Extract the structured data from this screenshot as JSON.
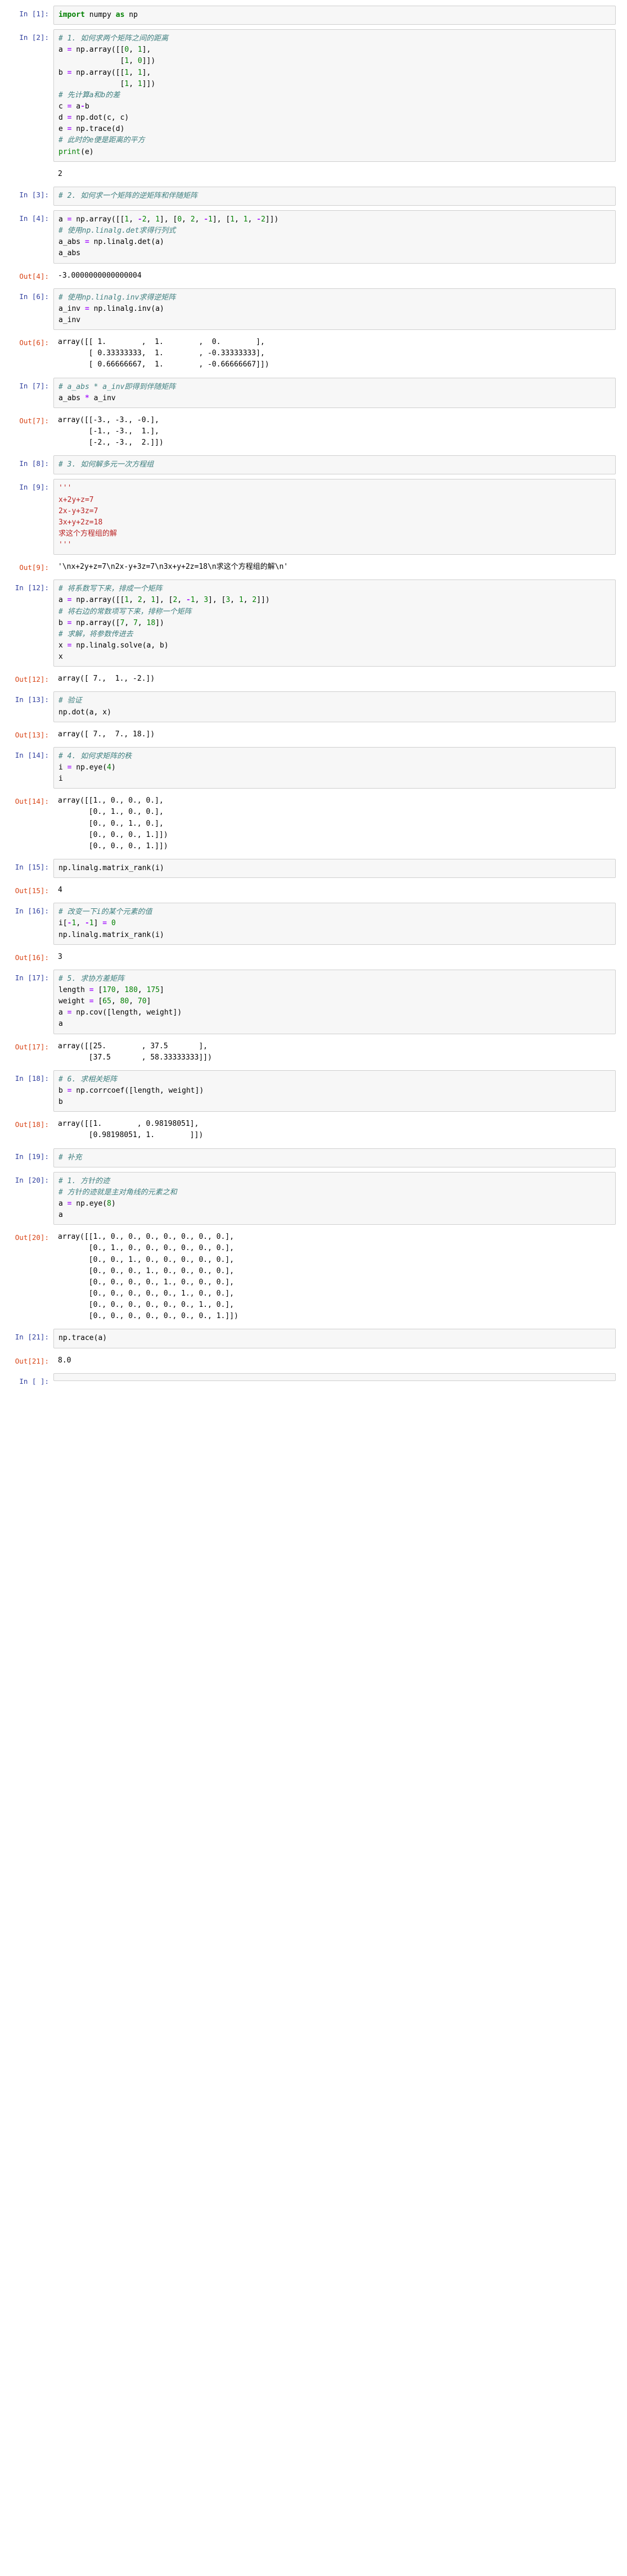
{
  "cells": [
    {
      "n": 1,
      "kind": "code",
      "source_html": "<span class='kw'>import</span> numpy <span class='kw'>as</span> np"
    },
    {
      "n": 2,
      "kind": "code",
      "source_html": "<span class='cm'># 1. 如何求两个矩阵之间的距离</span>\na <span class='op'>=</span> np.array([[<span class='num'>0</span>, <span class='num'>1</span>],\n              [<span class='num'>1</span>, <span class='num'>0</span>]])\nb <span class='op'>=</span> np.array([[<span class='num'>1</span>, <span class='num'>1</span>],\n              [<span class='num'>1</span>, <span class='num'>1</span>]])\n<span class='cm'># 先计算a和b的差</span>\nc <span class='op'>=</span> a<span class='op'>-</span>b\nd <span class='op'>=</span> np.dot(c, c)\ne <span class='op'>=</span> np.trace(d)\n<span class='cm'># 此时的e便是距离的平方</span>\n<span class='nm'>print</span>(e)",
      "stream": "2"
    },
    {
      "n": 3,
      "kind": "code",
      "source_html": "<span class='cm'># 2. 如何求一个矩阵的逆矩阵和伴随矩阵</span>"
    },
    {
      "n": 4,
      "kind": "code",
      "source_html": "a <span class='op'>=</span> np.array([[<span class='num'>1</span>, <span class='op'>-</span><span class='num'>2</span>, <span class='num'>1</span>], [<span class='num'>0</span>, <span class='num'>2</span>, <span class='op'>-</span><span class='num'>1</span>], [<span class='num'>1</span>, <span class='num'>1</span>, <span class='op'>-</span><span class='num'>2</span>]])\n<span class='cm'># 使用np.linalg.det求得行列式</span>\na_abs <span class='op'>=</span> np.linalg.det(a)\na_abs",
      "out": "-3.0000000000000004"
    },
    {
      "n": 6,
      "kind": "code",
      "source_html": "<span class='cm'># 使用np.linalg.inv求得逆矩阵</span>\na_inv <span class='op'>=</span> np.linalg.inv(a)\na_inv",
      "out": "array([[ 1.        ,  1.        ,  0.        ],\n       [ 0.33333333,  1.        , -0.33333333],\n       [ 0.66666667,  1.        , -0.66666667]])"
    },
    {
      "n": 7,
      "kind": "code",
      "source_html": "<span class='cm'># a_abs * a_inv即得到伴随矩阵</span>\na_abs <span class='op'>*</span> a_inv",
      "out": "array([[-3., -3., -0.],\n       [-1., -3.,  1.],\n       [-2., -3.,  2.]])"
    },
    {
      "n": 8,
      "kind": "code",
      "source_html": "<span class='cm'># 3. 如何解多元一次方程组</span>"
    },
    {
      "n": 9,
      "kind": "code",
      "source_html": "<span class='str'>'''</span>\n<span class='str'>x+2y+z=7</span>\n<span class='str'>2x-y+3z=7</span>\n<span class='str'>3x+y+2z=18</span>\n<span class='str'>求这个方程组的解</span>\n<span class='str'>'''</span>",
      "out": "'\\nx+2y+z=7\\n2x-y+3z=7\\n3x+y+2z=18\\n求这个方程组的解\\n'"
    },
    {
      "n": 12,
      "kind": "code",
      "source_html": "<span class='cm'># 将系数写下来，排成一个矩阵</span>\na <span class='op'>=</span> np.array([[<span class='num'>1</span>, <span class='num'>2</span>, <span class='num'>1</span>], [<span class='num'>2</span>, <span class='op'>-</span><span class='num'>1</span>, <span class='num'>3</span>], [<span class='num'>3</span>, <span class='num'>1</span>, <span class='num'>2</span>]])\n<span class='cm'># 将右边的常数项写下来，排称一个矩阵</span>\nb <span class='op'>=</span> np.array([<span class='num'>7</span>, <span class='num'>7</span>, <span class='num'>18</span>])\n<span class='cm'># 求解，将参数传进去</span>\nx <span class='op'>=</span> np.linalg.solve(a, b)\nx",
      "out": "array([ 7.,  1., -2.])"
    },
    {
      "n": 13,
      "kind": "code",
      "source_html": "<span class='cm'># 验证</span>\nnp.dot(a, x)",
      "out": "array([ 7.,  7., 18.])"
    },
    {
      "n": 14,
      "kind": "code",
      "source_html": "<span class='cm'># 4. 如何求矩阵的秩</span>\ni <span class='op'>=</span> np.eye(<span class='num'>4</span>)\ni",
      "out": "array([[1., 0., 0., 0.],\n       [0., 1., 0., 0.],\n       [0., 0., 1., 0.],\n       [0., 0., 0., 1.]])\n       [0., 0., 0., 1.]])"
    },
    {
      "n": 15,
      "kind": "code",
      "source_html": "np.linalg.matrix_rank(i)",
      "out": "4"
    },
    {
      "n": 16,
      "kind": "code",
      "source_html": "<span class='cm'># 改变一下i的某个元素的值</span>\ni[<span class='op'>-</span><span class='num'>1</span>, <span class='op'>-</span><span class='num'>1</span>] <span class='op'>=</span> <span class='num'>0</span>\nnp.linalg.matrix_rank(i)",
      "out": "3"
    },
    {
      "n": 17,
      "kind": "code",
      "source_html": "<span class='cm'># 5. 求协方差矩阵</span>\nlength <span class='op'>=</span> [<span class='num'>170</span>, <span class='num'>180</span>, <span class='num'>175</span>]\nweight <span class='op'>=</span> [<span class='num'>65</span>, <span class='num'>80</span>, <span class='num'>70</span>]\na <span class='op'>=</span> np.cov([length, weight])\na",
      "out": "array([[25.        , 37.5       ],\n       [37.5       , 58.33333333]])"
    },
    {
      "n": 18,
      "kind": "code",
      "source_html": "<span class='cm'># 6. 求相关矩阵</span>\nb <span class='op'>=</span> np.corrcoef([length, weight])\nb",
      "out": "array([[1.        , 0.98198051],\n       [0.98198051, 1.        ]])"
    },
    {
      "n": 19,
      "kind": "code",
      "source_html": "<span class='cm'># 补充</span>"
    },
    {
      "n": 20,
      "kind": "code",
      "source_html": "<span class='cm'># 1. 方针的迹</span>\n<span class='cm'># 方针的迹就是主对角线的元素之和</span>\na <span class='op'>=</span> np.eye(<span class='num'>8</span>)\na",
      "out": "array([[1., 0., 0., 0., 0., 0., 0., 0.],\n       [0., 1., 0., 0., 0., 0., 0., 0.],\n       [0., 0., 1., 0., 0., 0., 0., 0.],\n       [0., 0., 0., 1., 0., 0., 0., 0.],\n       [0., 0., 0., 0., 1., 0., 0., 0.],\n       [0., 0., 0., 0., 0., 1., 0., 0.],\n       [0., 0., 0., 0., 0., 0., 1., 0.],\n       [0., 0., 0., 0., 0., 0., 0., 1.]])"
    },
    {
      "n": 21,
      "kind": "code",
      "source_html": "np.trace(a)",
      "out": "8.0"
    },
    {
      "n": null,
      "kind": "code",
      "source_html": ""
    }
  ],
  "labels": {
    "in_prefix": "In [",
    "out_prefix": "Out[",
    "suffix": "]:"
  }
}
